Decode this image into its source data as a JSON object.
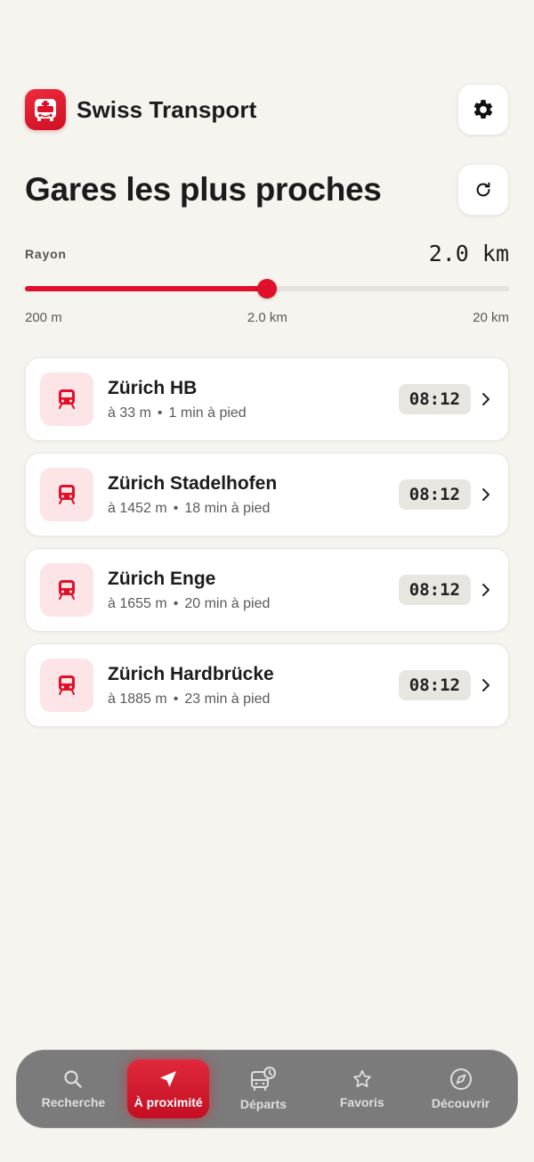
{
  "app": {
    "title": "Swiss Transport",
    "accent_color": "#e0102a"
  },
  "page": {
    "title": "Gares les plus proches"
  },
  "radius": {
    "label": "Rayon",
    "value_display": "2.0 km",
    "value_km": 2.0,
    "fraction": 0.5,
    "min_label": "200 m",
    "mid_label": "2.0 km",
    "max_label": "20 km"
  },
  "stations": [
    {
      "name": "Zürich HB",
      "distance": "à 33 m",
      "walk": "1 min à pied",
      "time": "08:12",
      "icon": "train-icon"
    },
    {
      "name": "Zürich Stadelhofen",
      "distance": "à 1452 m",
      "walk": "18 min à pied",
      "time": "08:12",
      "icon": "train-icon"
    },
    {
      "name": "Zürich Enge",
      "distance": "à 1655 m",
      "walk": "20 min à pied",
      "time": "08:12",
      "icon": "train-icon"
    },
    {
      "name": "Zürich Hardbrücke",
      "distance": "à 1885 m",
      "walk": "23 min à pied",
      "time": "08:12",
      "icon": "train-icon"
    }
  ],
  "nav": {
    "items": [
      {
        "label": "Recherche",
        "icon": "search-icon",
        "active": false
      },
      {
        "label": "À proximité",
        "icon": "location-arrow-icon",
        "active": true
      },
      {
        "label": "Départs",
        "icon": "bus-clock-icon",
        "active": false
      },
      {
        "label": "Favoris",
        "icon": "star-icon",
        "active": false
      },
      {
        "label": "Découvrir",
        "icon": "compass-icon",
        "active": false
      }
    ]
  }
}
